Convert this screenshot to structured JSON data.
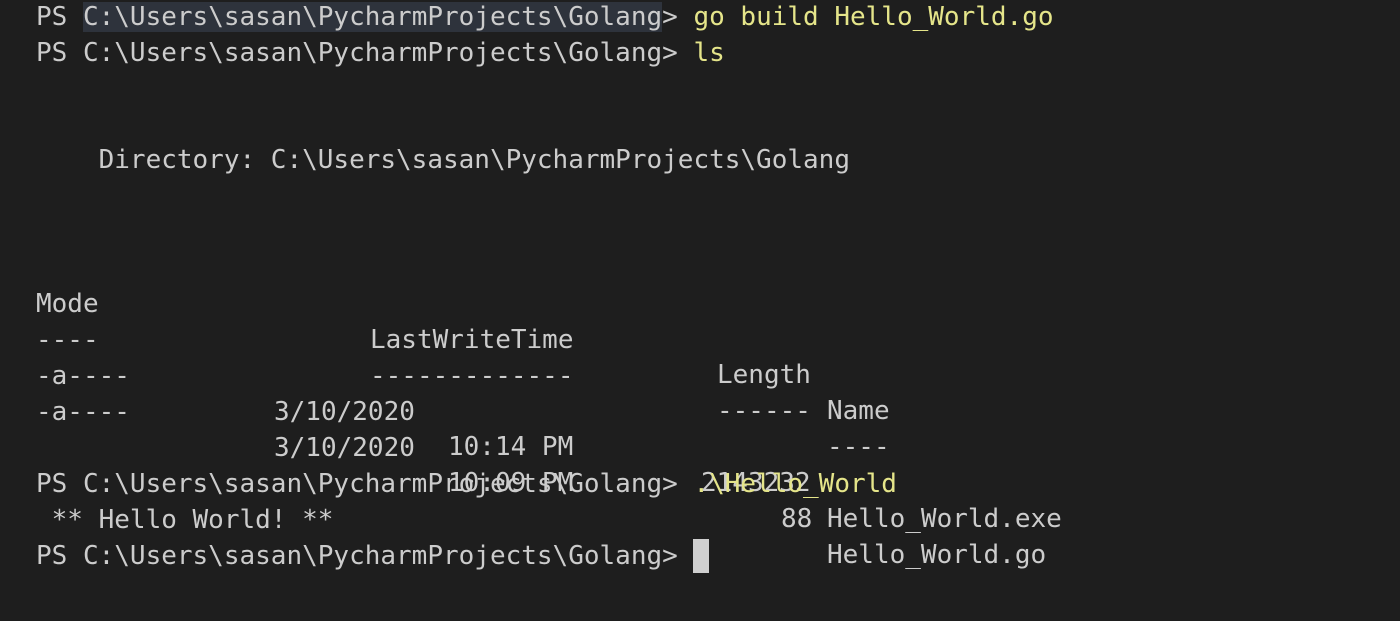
{
  "terminal": {
    "lines": {
      "l1": {
        "ps": "PS ",
        "path": "C:\\Users\\sasan\\PycharmProjects\\Golang",
        "gt": "> ",
        "cmd": "go build Hello_World.go"
      },
      "l2": {
        "prompt": "PS C:\\Users\\sasan\\PycharmProjects\\Golang> ",
        "cmd": "ls"
      },
      "directory": "    Directory: C:\\Users\\sasan\\PycharmProjects\\Golang",
      "headers": {
        "mode": "Mode",
        "lastwritetime": "LastWriteTime",
        "length": "Length",
        "name": "Name"
      },
      "underlines": {
        "mode": "----",
        "lastwritetime": "-------------",
        "length": "------",
        "name": "----"
      },
      "rows": [
        {
          "mode": "-a----",
          "date": "3/10/2020",
          "time": "10:14 PM",
          "length": "2143232",
          "name": "Hello_World.exe"
        },
        {
          "mode": "-a----",
          "date": "3/10/2020",
          "time": "10:09 PM",
          "length": "88",
          "name": "Hello_World.go"
        }
      ],
      "l3": {
        "prompt": "PS C:\\Users\\sasan\\PycharmProjects\\Golang> ",
        "cmd": ".\\Hello_World"
      },
      "output": " ** Hello World! **",
      "l4": {
        "prompt": "PS C:\\Users\\sasan\\PycharmProjects\\Golang> "
      }
    },
    "colors": {
      "background": "#1e1e1e",
      "text": "#cccccc",
      "command": "#e5e58a",
      "cursor": "#cfcfcf"
    }
  }
}
